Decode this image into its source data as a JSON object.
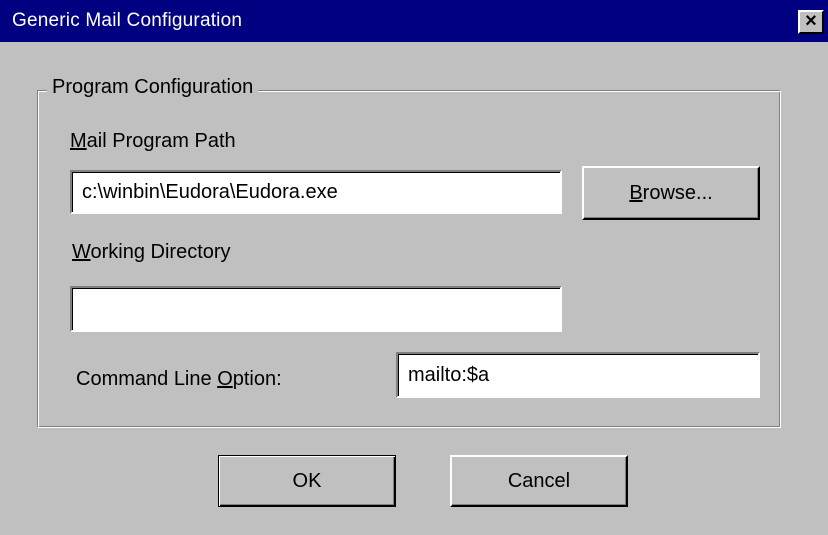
{
  "window": {
    "title": "Generic Mail Configuration",
    "close_label": "×"
  },
  "group": {
    "legend": "Program Configuration"
  },
  "mail_program_path": {
    "label_accel": "M",
    "label_rest": "ail Program Path",
    "value": "c:\\winbin\\Eudora\\Eudora.exe"
  },
  "browse_button": {
    "label_accel": "B",
    "label_rest": "rowse..."
  },
  "working_directory": {
    "label_accel": "W",
    "label_rest": "orking Directory",
    "value": ""
  },
  "command_line_option": {
    "label_before": "Command Line ",
    "label_accel": "O",
    "label_after": "ption:",
    "value": "mailto:$a"
  },
  "buttons": {
    "ok": "OK",
    "cancel": "Cancel"
  },
  "colors": {
    "titlebar": "#000080",
    "face": "#c0c0c0"
  }
}
